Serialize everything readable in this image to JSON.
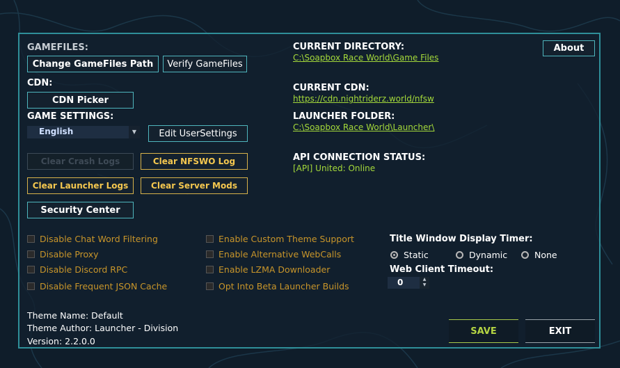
{
  "gamefiles": {
    "header": "GAMEFILES:",
    "change_path_label": "Change GameFiles Path",
    "verify_label": "Verify GameFiles"
  },
  "cdn": {
    "header": "CDN:",
    "picker_label": "CDN Picker"
  },
  "game_settings": {
    "header": "GAME SETTINGS:",
    "language_selected": "English",
    "edit_usersettings_label": "Edit UserSettings"
  },
  "logs": {
    "clear_crash_logs_label": "Clear Crash Logs",
    "clear_nfswo_log_label": "Clear NFSWO Log",
    "clear_launcher_logs_label": "Clear Launcher Logs",
    "clear_server_mods_label": "Clear Server Mods"
  },
  "security_center_label": "Security Center",
  "about_label": "About",
  "info_panel": {
    "current_directory_header": "CURRENT DIRECTORY:",
    "current_directory_value": "C:\\Soapbox Race World\\Game Files",
    "current_cdn_header": "CURRENT CDN:",
    "current_cdn_value": "https://cdn.nightriderz.world/nfsw",
    "launcher_folder_header": "LAUNCHER FOLDER:",
    "launcher_folder_value": "C:\\Soapbox Race World\\Launcher\\",
    "api_status_header": "API CONNECTION STATUS:",
    "api_status_value": "[API] United: Online"
  },
  "checkboxes_left": [
    {
      "label": "Disable Chat Word Filtering",
      "checked": false
    },
    {
      "label": "Disable Proxy",
      "checked": false
    },
    {
      "label": "Disable Discord RPC",
      "checked": false
    },
    {
      "label": "Disable Frequent JSON Cache",
      "checked": false
    }
  ],
  "checkboxes_right": [
    {
      "label": "Enable Custom Theme Support",
      "checked": false
    },
    {
      "label": "Enable Alternative WebCalls",
      "checked": false
    },
    {
      "label": "Enable LZMA Downloader",
      "checked": false
    },
    {
      "label": "Opt Into Beta Launcher Builds",
      "checked": false
    }
  ],
  "title_timer": {
    "header": "Title Window Display Timer:",
    "options": [
      "Static",
      "Dynamic",
      "None"
    ],
    "selected": "Static"
  },
  "web_timeout": {
    "header": "Web Client Timeout:",
    "value": "0"
  },
  "theme": {
    "name": "Theme Name: Default",
    "author": "Theme Author: Launcher - Division",
    "version": "Version: 2.2.0.0"
  },
  "actions": {
    "save_label": "SAVE",
    "exit_label": "EXIT"
  },
  "colors": {
    "accent_border": "#2f8f99",
    "link_green": "#a4d93a",
    "warning_yellow": "#f4c74f",
    "checkbox_text": "#c8952a"
  }
}
